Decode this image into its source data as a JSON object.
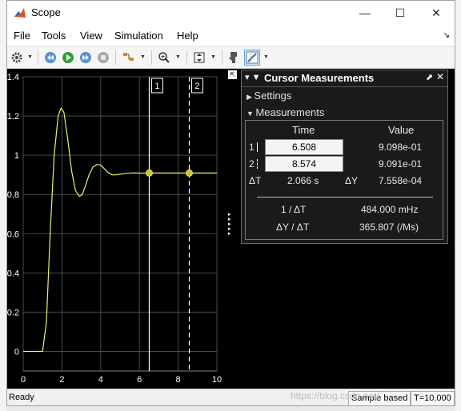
{
  "window": {
    "title": "Scope",
    "minimize_glyph": "—",
    "maximize_glyph": "☐",
    "close_glyph": "✕"
  },
  "menu": [
    "File",
    "Tools",
    "View",
    "Simulation",
    "Help"
  ],
  "toolbar_icons": [
    "settings-icon",
    "step-back-icon",
    "run-icon",
    "step-forward-icon",
    "stop-icon",
    "highlight-block-icon",
    "zoom-icon",
    "scale-axes-icon",
    "data-cursors-icon",
    "cursor-measurements-icon"
  ],
  "plot": {
    "background": "#000000",
    "signal_color": "#f0f070",
    "cursor_color": "#ffffff",
    "x_ticks": [
      "0",
      "2",
      "4",
      "6",
      "8",
      "10"
    ],
    "y_ticks": [
      "1.4",
      "1.2",
      "1",
      "0.8",
      "0.6",
      "0.4",
      "0.2",
      "0"
    ],
    "cursor1_label": "1",
    "cursor2_label": "2"
  },
  "chart_data": {
    "type": "line",
    "xlim": [
      0,
      10
    ],
    "ylim": [
      -0.1,
      1.4
    ],
    "grid": true,
    "series": [
      {
        "x": [
          0,
          1,
          1.2,
          1.4,
          1.6,
          1.8,
          1.95,
          2.1,
          2.3,
          2.5,
          2.7,
          2.9,
          3.05,
          3.2,
          3.4,
          3.6,
          3.8,
          4.0,
          4.2,
          4.4,
          4.6,
          4.8,
          5.0,
          5.2,
          5.4,
          5.7,
          6.0,
          6.3,
          6.508,
          7.0,
          7.5,
          8.0,
          8.574,
          9.0,
          9.5,
          10
        ],
        "y": [
          0,
          0,
          0.15,
          0.62,
          1.0,
          1.2,
          1.24,
          1.22,
          1.08,
          0.92,
          0.82,
          0.79,
          0.8,
          0.84,
          0.9,
          0.94,
          0.953,
          0.95,
          0.93,
          0.91,
          0.9,
          0.9,
          0.903,
          0.906,
          0.908,
          0.91,
          0.909,
          0.909,
          0.9098,
          0.9094,
          0.9091,
          0.9091,
          0.9091,
          0.9091,
          0.9091,
          0.9091
        ]
      }
    ],
    "cursors": [
      6.508,
      8.574
    ]
  },
  "measurements_panel": {
    "title": "Cursor Measurements",
    "settings_label": "Settings",
    "measurements_label": "Measurements",
    "time_header": "Time",
    "value_header": "Value",
    "row1_index": "1",
    "row1_time": "6.508",
    "row1_value": "9.098e-01",
    "row2_index": "2",
    "row2_time": "8.574",
    "row2_value": "9.091e-01",
    "dt_label": "ΔT",
    "dt_value": "2.066 s",
    "dy_label": "ΔY",
    "dy_value": "7.558e-04",
    "inv_dt_label": "1 / ΔT",
    "inv_dt_value": "484.000 mHz",
    "slope_label": "ΔY / ΔT",
    "slope_value": "365.807 (/Ms)"
  },
  "status": {
    "ready": "Ready",
    "sample_mode": "Sample based",
    "time": "T=10.000"
  },
  "watermark": "https://blog.csdn.net/"
}
